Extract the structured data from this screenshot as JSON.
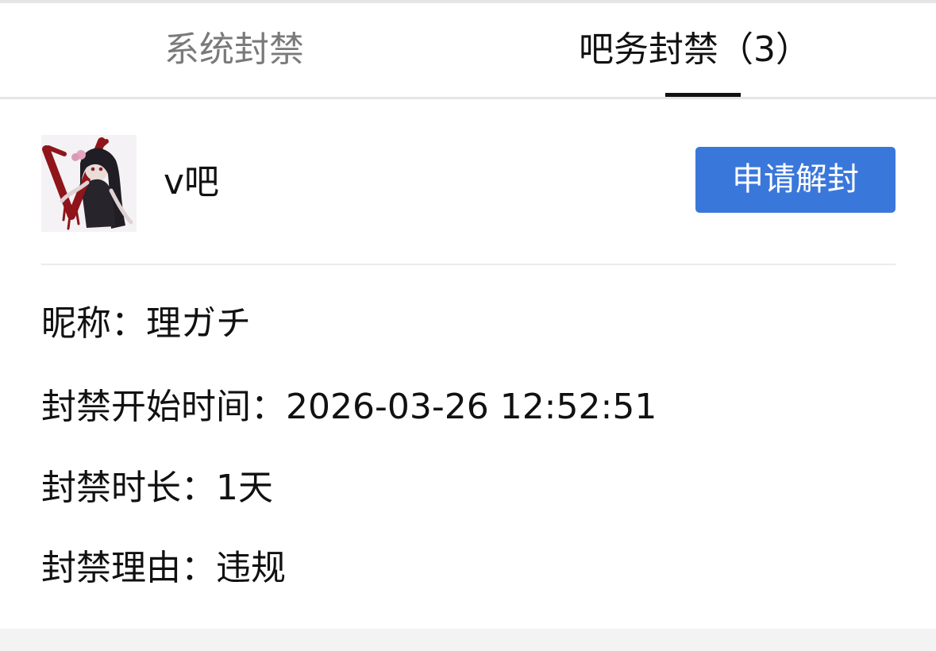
{
  "tabs": [
    {
      "label": "系统封禁",
      "active": false
    },
    {
      "label": "吧务封禁（3）",
      "active": true
    }
  ],
  "ban_card": {
    "avatar_icon": "forum-avatar-image",
    "forum_name": "v吧",
    "unban_button_label": "申请解封",
    "nickname_label": "昵称：",
    "nickname_value": "理ガチ",
    "start_time_label": "封禁开始时间：",
    "start_time_value": "2026-03-26 12:52:51",
    "duration_label": "封禁时长：",
    "duration_value": "1天",
    "reason_label": "封禁理由：",
    "reason_value": "违规"
  },
  "colors": {
    "accent": "#3a77db",
    "active_tab": "#111111",
    "inactive_tab": "#7a7a7a",
    "divider": "#e5e5e5"
  }
}
